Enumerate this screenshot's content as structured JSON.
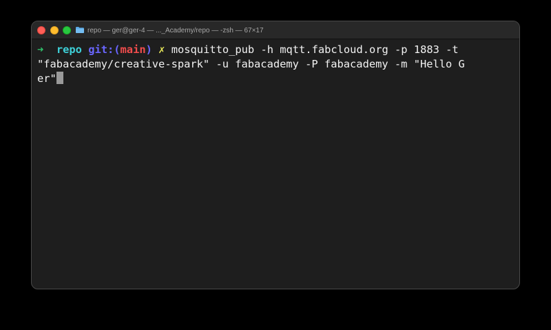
{
  "window": {
    "title": "repo — ger@ger-4 — ..._Academy/repo — -zsh — 67×17",
    "title_icon": "folder-icon",
    "controls": [
      "close",
      "minimize",
      "zoom"
    ],
    "colors": {
      "background": "#1e1e1e",
      "close": "#ff5f57",
      "minimize": "#febc2e",
      "zoom": "#28c840"
    }
  },
  "prompt": {
    "arrow": "➜",
    "directory": "repo",
    "git_label": "git:(",
    "branch": "main",
    "git_close": ")",
    "dirty_marker": "✗",
    "colors": {
      "arrow": "#2fc26b",
      "directory": "#3ed0d8",
      "git_label": "#6a66ff",
      "branch": "#f04c4c",
      "dirty_marker": "#e8e85a"
    }
  },
  "command": {
    "line1": "mosquitto_pub -h mqtt.fabcloud.org -p 1883 -t",
    "line2": "\"fabacademy/creative-spark\" -u fabacademy -P fabacademy -m \"Hello G",
    "line3": "er\""
  }
}
